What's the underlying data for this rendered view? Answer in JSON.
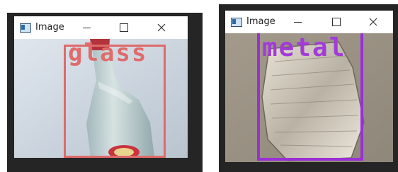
{
  "windows": [
    {
      "title": "Image",
      "detection_label": "glass",
      "label_color": "#e06b6b",
      "box_color": "#df6a6a"
    },
    {
      "title": "Image",
      "detection_label": "metal",
      "label_color": "#a23bd8",
      "box_color": "#9a2fd6"
    }
  ],
  "icons": [
    "app-icon",
    "minimize-icon",
    "maximize-icon",
    "close-icon"
  ]
}
